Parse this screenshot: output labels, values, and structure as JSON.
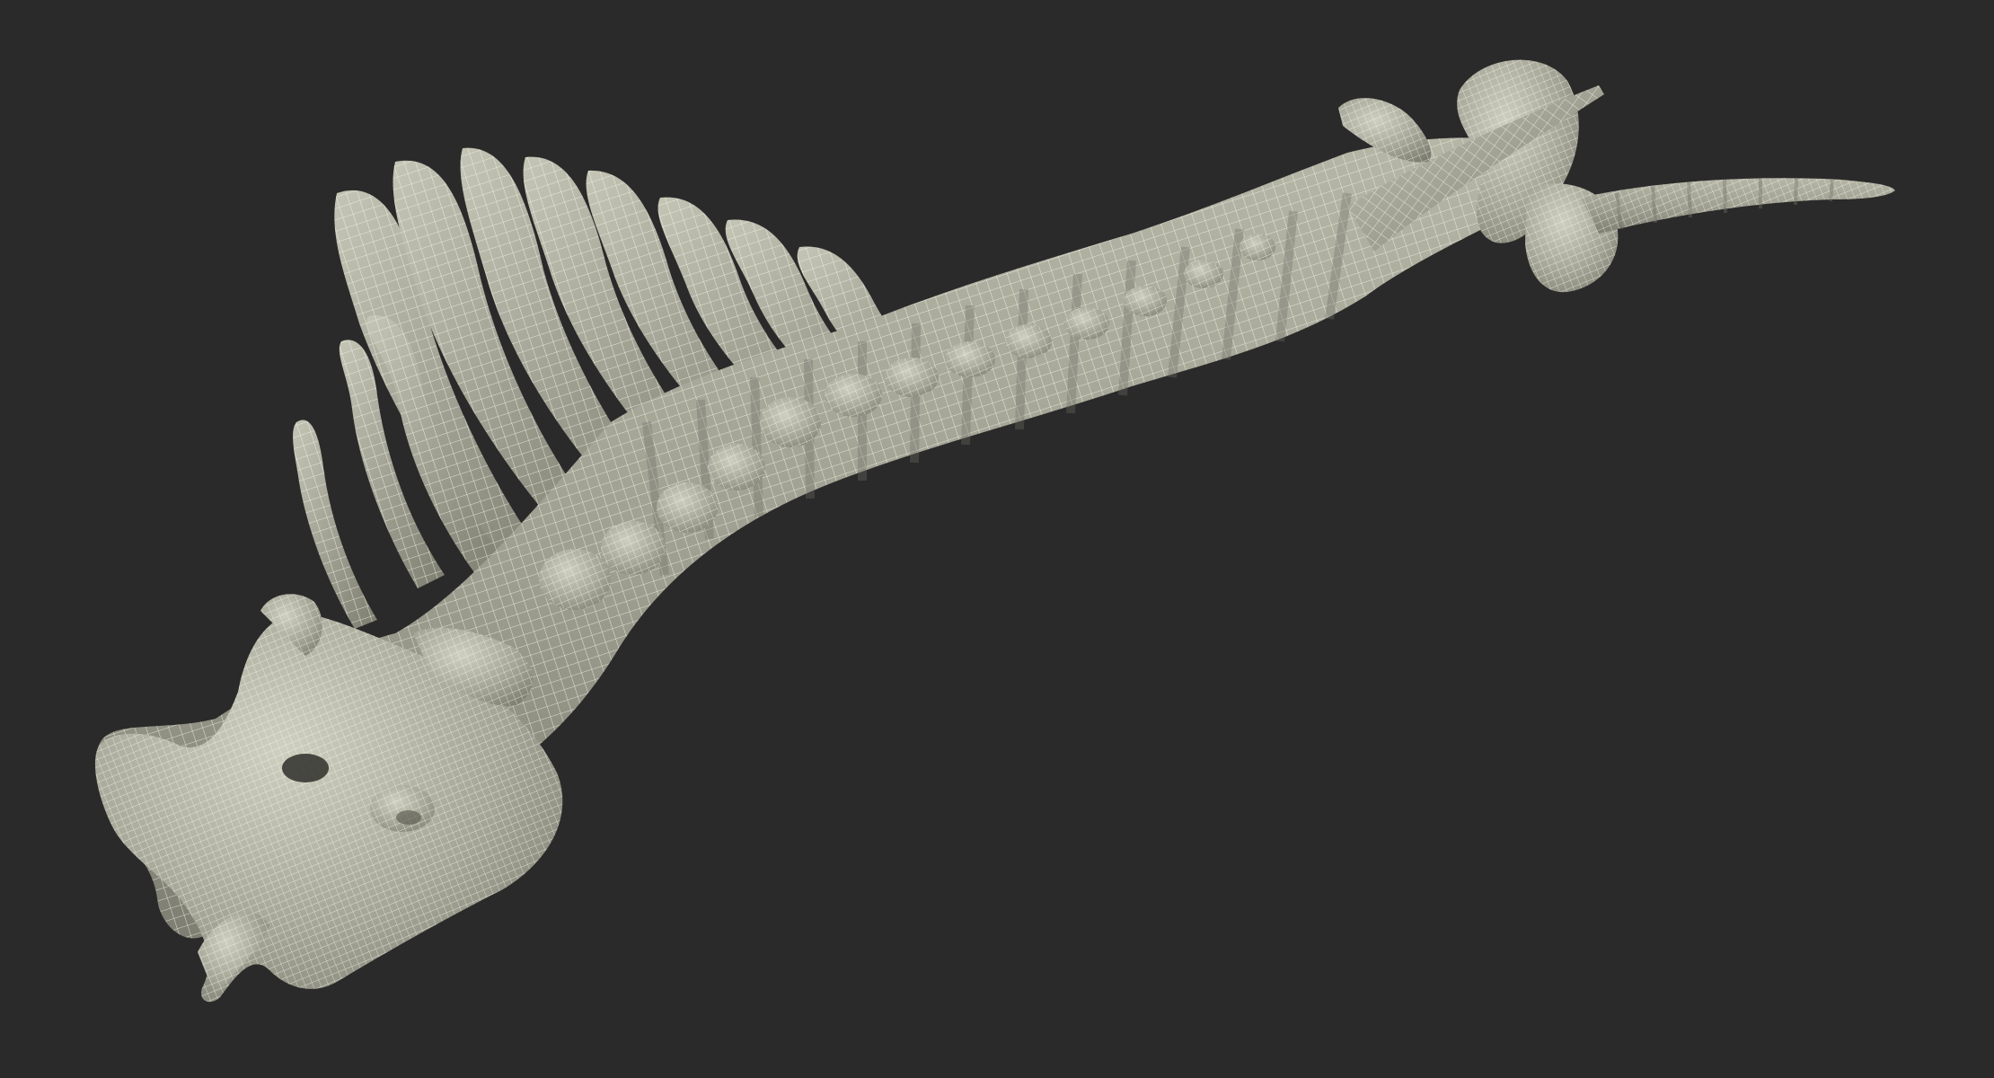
{
  "scene": {
    "background_color": "#2a2a2a",
    "model_fill_color": "#a7a798",
    "model_shadow_color": "#7b7b6e",
    "model_highlight_color": "#d9d9c8",
    "wireframe_color": "#f4f4ea",
    "subject": "spine-skeleton-wireframe-render"
  }
}
